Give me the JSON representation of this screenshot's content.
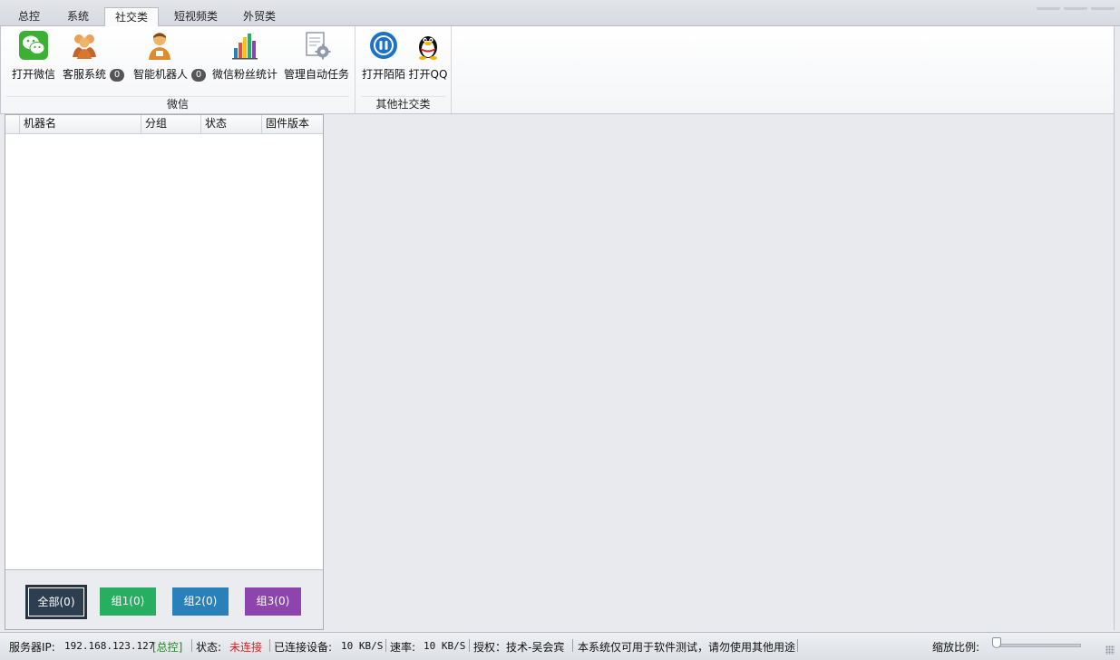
{
  "tabs": [
    {
      "label": "总控",
      "active": false
    },
    {
      "label": "系统",
      "active": false
    },
    {
      "label": "社交类",
      "active": true
    },
    {
      "label": "短视频类",
      "active": false
    },
    {
      "label": "外贸类",
      "active": false
    }
  ],
  "ribbon": {
    "wechat_group": {
      "label": "微信",
      "buttons": {
        "open_wechat": {
          "label": "打开微信",
          "icon": "wechat-icon"
        },
        "customer_service": {
          "label": "客服系统",
          "icon": "customer-service-icon",
          "badge": "0"
        },
        "smart_robot": {
          "label": "智能机器人",
          "icon": "robot-agent-icon",
          "badge": "0"
        },
        "fans_stats": {
          "label": "微信粉丝统计",
          "icon": "bar-chart-icon"
        },
        "auto_tasks": {
          "label": "管理自动任务",
          "icon": "task-settings-icon"
        }
      }
    },
    "other_group": {
      "label": "其他社交类",
      "buttons": {
        "open_momo": {
          "label": "打开陌陌",
          "icon": "momo-icon"
        },
        "open_qq": {
          "label": "打开QQ",
          "icon": "qq-penguin-icon"
        }
      }
    }
  },
  "device_table": {
    "columns": [
      "机器名",
      "分组",
      "状态",
      "固件版本"
    ],
    "rows": []
  },
  "groups": [
    {
      "label": "全部(0)",
      "color": "#2d3e50"
    },
    {
      "label": "组1(0)",
      "color": "#27ae60"
    },
    {
      "label": "组2(0)",
      "color": "#2a80b9"
    },
    {
      "label": "组3(0)",
      "color": "#8e44ad"
    }
  ],
  "status": {
    "server_ip_label": "服务器IP:",
    "server_ip": "192.168.123.127",
    "mode": "[总控]",
    "state_label": "状态:",
    "state_value": "未连接",
    "connected_label": "已连接设备:",
    "connected_value": "10 KB/S",
    "rate_label": "速率:",
    "rate_value": "10 KB/S",
    "license": "授权：技术-吴会宾",
    "notice": "本系统仅可用于软件测试，请勿使用其他用途",
    "zoom_label": "缩放比例:"
  },
  "colors": {
    "accent": "#2a80b9",
    "status_error": "#e02020",
    "status_mode": "#1a8a1a"
  }
}
